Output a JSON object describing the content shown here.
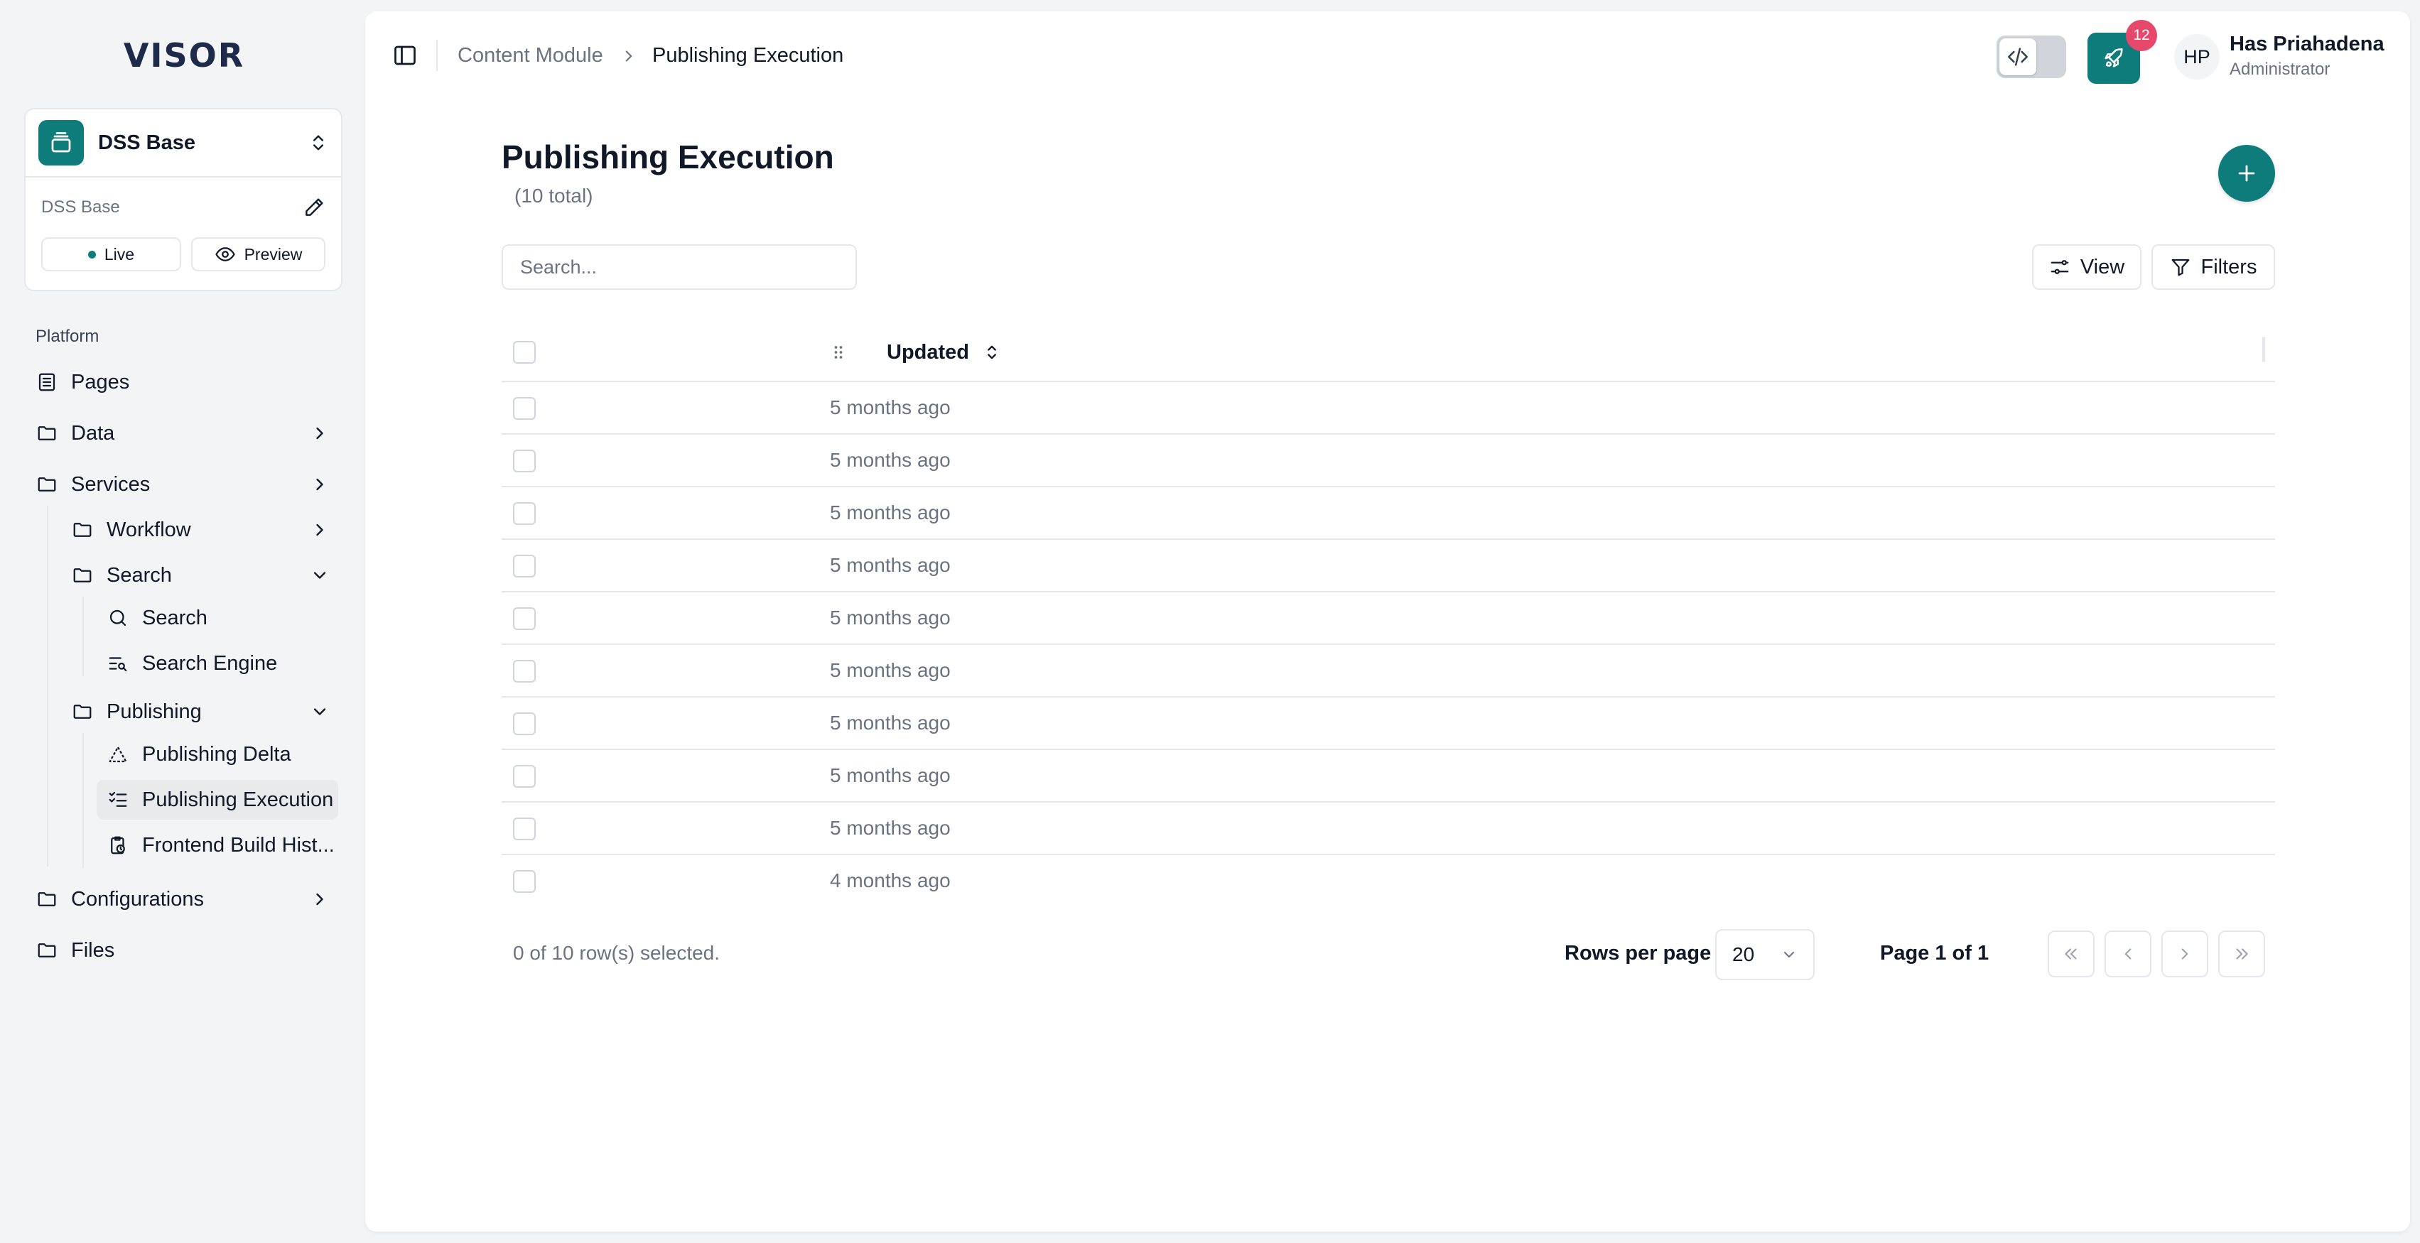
{
  "brand": {
    "logo_text": "VISOR"
  },
  "site": {
    "name": "DSS Base",
    "subtitle": "DSS Base",
    "live_label": "Live",
    "preview_label": "Preview"
  },
  "nav": {
    "group_label": "Platform",
    "pages": "Pages",
    "data": "Data",
    "services": "Services",
    "workflow": "Workflow",
    "search_folder": "Search",
    "search": "Search",
    "search_engine": "Search Engine",
    "publishing": "Publishing",
    "publishing_delta": "Publishing Delta",
    "publishing_execution": "Publishing Execution",
    "frontend_build_history": "Frontend Build Hist...",
    "configurations": "Configurations",
    "files": "Files"
  },
  "breadcrumb": {
    "parent": "Content Module",
    "current": "Publishing Execution"
  },
  "header": {
    "notification_count": "12",
    "avatar_initials": "HP",
    "user_name": "Has Priahadena",
    "user_role": "Administrator"
  },
  "page": {
    "title": "Publishing Execution",
    "count": "(10 total)"
  },
  "toolbar": {
    "search_placeholder": "Search...",
    "view_label": "View",
    "filters_label": "Filters"
  },
  "table": {
    "columns": [
      "Updated"
    ],
    "rows": [
      {
        "updated": "5 months ago"
      },
      {
        "updated": "5 months ago"
      },
      {
        "updated": "5 months ago"
      },
      {
        "updated": "5 months ago"
      },
      {
        "updated": "5 months ago"
      },
      {
        "updated": "5 months ago"
      },
      {
        "updated": "5 months ago"
      },
      {
        "updated": "5 months ago"
      },
      {
        "updated": "5 months ago"
      },
      {
        "updated": "4 months ago"
      }
    ]
  },
  "footer": {
    "selection": "0 of 10 row(s) selected.",
    "rows_per_page_label": "Rows per page",
    "rows_per_page_value": "20",
    "page_info": "Page 1 of 1"
  },
  "colors": {
    "accent": "#0f7c7c",
    "badge": "#e5486b",
    "logo": "#1e2a4a"
  }
}
